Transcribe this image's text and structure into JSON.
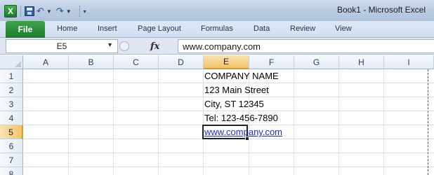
{
  "window": {
    "title": "Book1  -  Microsoft Excel"
  },
  "quick_access": {
    "app_icon": "excel-logo-icon",
    "app_letter": "X",
    "save": "save-icon",
    "undo": "undo-icon",
    "redo": "redo-icon",
    "customize": "customize-qat-icon"
  },
  "ribbon": {
    "file_tab": "File",
    "tabs": [
      "Home",
      "Insert",
      "Page Layout",
      "Formulas",
      "Data",
      "Review",
      "View"
    ]
  },
  "formula_bar": {
    "name_box": "E5",
    "fx": "fx",
    "value": "www.company.com"
  },
  "grid": {
    "columns": [
      "A",
      "B",
      "C",
      "D",
      "E",
      "F",
      "G",
      "H",
      "I"
    ],
    "rows": [
      "1",
      "2",
      "3",
      "4",
      "5",
      "6",
      "7",
      "8"
    ],
    "active_cell": "E5",
    "cells": {
      "E1": "COMPANY NAME",
      "E2": "123 Main Street",
      "E3": "City, ST 12345",
      "E4": "Tel: 123-456-7890",
      "E5": "www.company.com"
    },
    "hyperlink_color": "#1d2dc8",
    "accent_selection": "#f1c46a"
  }
}
